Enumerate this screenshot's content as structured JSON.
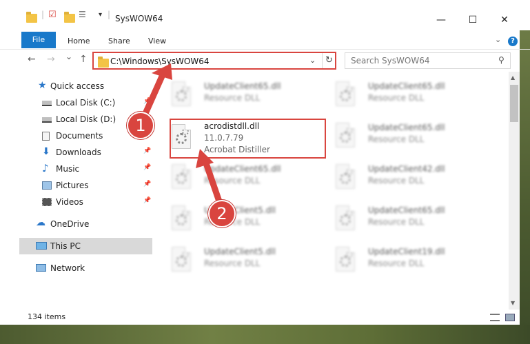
{
  "window": {
    "title": "SysWOW64",
    "minimize": "—",
    "maximize": "☐",
    "close": "✕"
  },
  "ribbon": {
    "file": "File",
    "home": "Home",
    "share": "Share",
    "view": "View",
    "help": "?"
  },
  "nav": {
    "back": "←",
    "forward": "→",
    "recent": "⌄",
    "up": "↑",
    "address": "C:\\Windows\\SysWOW64",
    "address_dropdown": "⌄",
    "refresh": "↻",
    "search_placeholder": "Search SysWOW64"
  },
  "sidebar": {
    "items": [
      {
        "label": "Quick access",
        "icon": "star-icon"
      },
      {
        "label": "Local Disk (C:)",
        "icon": "drive-icon"
      },
      {
        "label": "Local Disk (D:)",
        "icon": "drive-icon"
      },
      {
        "label": "Documents",
        "icon": "documents-icon"
      },
      {
        "label": "Downloads",
        "icon": "download-icon"
      },
      {
        "label": "Music",
        "icon": "music-icon"
      },
      {
        "label": "Pictures",
        "icon": "pictures-icon"
      },
      {
        "label": "Videos",
        "icon": "videos-icon"
      },
      {
        "label": "OneDrive",
        "icon": "cloud-icon"
      },
      {
        "label": "This PC",
        "icon": "computer-icon"
      },
      {
        "label": "Network",
        "icon": "network-icon"
      }
    ]
  },
  "files": {
    "highlighted": {
      "name": "acrodistdll.dll",
      "version": "11.0.7.79",
      "description": "Acrobat Distiller"
    },
    "blurred": [
      {
        "name": "UpdateClient65.dll",
        "type": "Resource DLL"
      },
      {
        "name": "UpdateClient65.dll",
        "type": "Resource DLL"
      },
      {
        "name": "UpdateClient65.dll",
        "type": "Resource DLL"
      },
      {
        "name": "UpdateClient65.dll",
        "type": "Resource DLL"
      },
      {
        "name": "UpdateClient42.dll",
        "type": "Resource DLL"
      },
      {
        "name": "UpdateClient5.dll",
        "type": "Resource DLL"
      },
      {
        "name": "UpdateClient65.dll",
        "type": "Resource DLL"
      },
      {
        "name": "UpdateClient5.dll",
        "type": "Resource DLL"
      },
      {
        "name": "UpdateClient19.dll",
        "type": "Resource DLL"
      }
    ]
  },
  "status": {
    "item_count": "134 items"
  },
  "annotations": {
    "step1": "1",
    "step2": "2",
    "color": "#d9453f"
  }
}
